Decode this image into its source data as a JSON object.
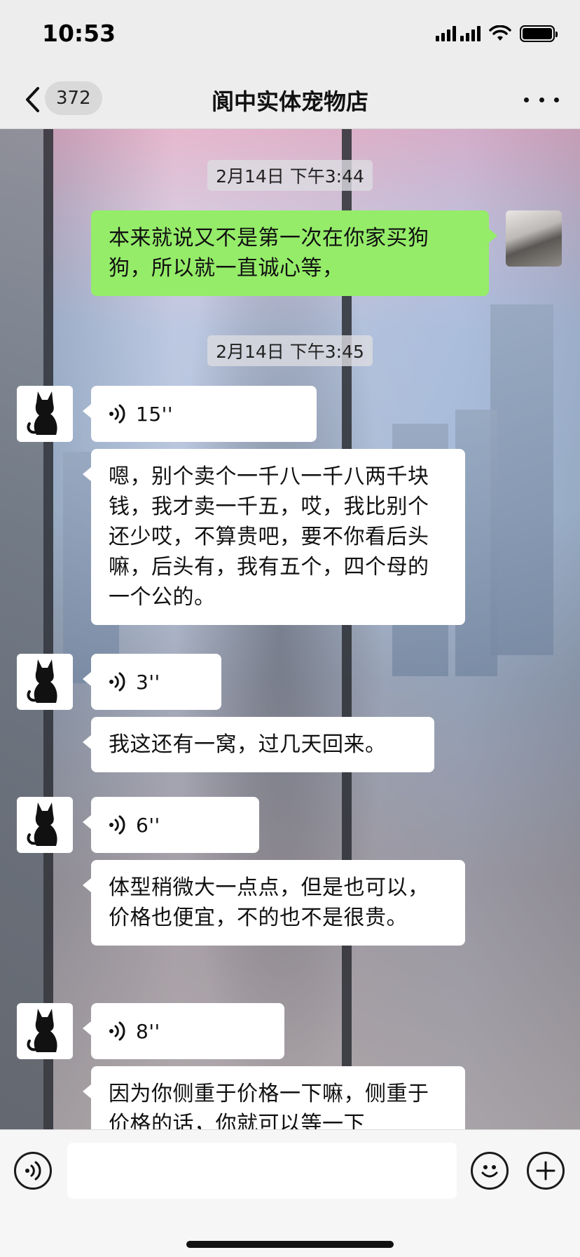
{
  "status_bar": {
    "time": "10:53"
  },
  "nav": {
    "unread_count": "372",
    "title": "阆中实体宠物店"
  },
  "messages": {
    "ts1": "2月14日 下午3:44",
    "ts2": "2月14日 下午3:45",
    "m1_text": "本来就说又不是第一次在你家买狗狗，所以就一直诚心等，",
    "v1_duration": "15''",
    "m2_text": "嗯，别个卖个一千八一千八两千块钱，我才卖一千五，哎，我比别个还少哎，不算贵吧，要不你看后头嘛，后头有，我有五个，四个母的一个公的。",
    "v2_duration": "3''",
    "m3_text": "我这还有一窝，过几天回来。",
    "v3_duration": "6''",
    "m4_text": "体型稍微大一点点，但是也可以，价格也便宜，不的也不是很贵。",
    "v4_duration": "8''",
    "m5_text": "因为你侧重于价格一下嘛，侧重于价格的话，你就可以等一下"
  },
  "input": {
    "placeholder": ""
  },
  "colors": {
    "sent_bubble": "#95ec69",
    "received_bubble": "#ffffff",
    "background": "#ededed"
  },
  "icons": [
    "back-chevron-icon",
    "more-icon",
    "voice-wave-icon",
    "cat-avatar-icon",
    "voice-input-icon",
    "emoji-icon",
    "plus-icon"
  ]
}
